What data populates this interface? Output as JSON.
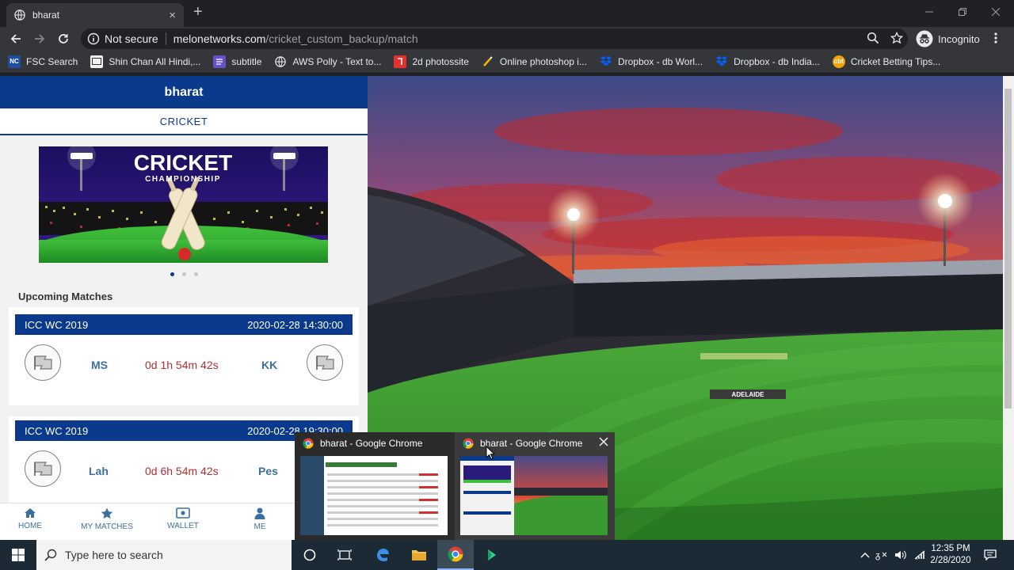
{
  "browser": {
    "tab_title": "bharat",
    "tab_close": "×",
    "new_tab": "+",
    "security_label": "Not secure",
    "url_host": "melonetworks.com",
    "url_path": "/cricket_custom_backup/match",
    "profile_label": "Incognito"
  },
  "bookmarks": [
    {
      "label": "FSC Search",
      "icon": "fsc-icon",
      "color": "#1f4e9c"
    },
    {
      "label": "Shin Chan All Hindi,...",
      "icon": "tv-icon",
      "color": "#f2f2f2"
    },
    {
      "label": "subtitle",
      "icon": "doc-icon",
      "color": "#6a4fc9"
    },
    {
      "label": "AWS Polly - Text to...",
      "icon": "globe-icon",
      "color": "#5f6368"
    },
    {
      "label": "2d photossite",
      "icon": "photo-icon",
      "color": "#e3312d"
    },
    {
      "label": "Online photoshop i...",
      "icon": "brush-icon",
      "color": "#f4b400"
    },
    {
      "label": "Dropbox - db Worl...",
      "icon": "dropbox-icon",
      "color": "#0061ff"
    },
    {
      "label": "Dropbox - db India...",
      "icon": "dropbox-icon",
      "color": "#0061ff"
    },
    {
      "label": "Cricket Betting Tips...",
      "icon": "cbt-icon",
      "color": "#f0a30a"
    }
  ],
  "app": {
    "title": "bharat",
    "subnav": "CRICKET",
    "banner_title": "CRICKET",
    "banner_subtitle": "CHAMPIONSHIP",
    "section_title": "Upcoming Matches",
    "matches": [
      {
        "league": "ICC WC 2019",
        "datetime": "2020-02-28 14:30:00",
        "team_a": "MS",
        "countdown": "0d 1h 54m 42s",
        "team_b": "KK"
      },
      {
        "league": "ICC WC 2019",
        "datetime": "2020-02-28 19:30:00",
        "team_a": "Lah",
        "countdown": "0d 6h 54m 42s",
        "team_b": "Pes"
      }
    ],
    "nav": [
      {
        "label": "HOME",
        "icon": "home-icon"
      },
      {
        "label": "MY MATCHES",
        "icon": "star-icon"
      },
      {
        "label": "WALLET",
        "icon": "wallet-icon"
      },
      {
        "label": "ME",
        "icon": "user-icon"
      }
    ],
    "accent_color": "#0b3a8c",
    "countdown_color": "#b03030"
  },
  "hero_image": {
    "stadium_sign": "ADELAIDE"
  },
  "thumbnails": [
    {
      "title": "bharat - Google Chrome"
    },
    {
      "title": "bharat - Google Chrome"
    }
  ],
  "taskbar": {
    "search_placeholder": "Type here to search",
    "time": "12:35 PM",
    "date": "2/28/2020"
  }
}
